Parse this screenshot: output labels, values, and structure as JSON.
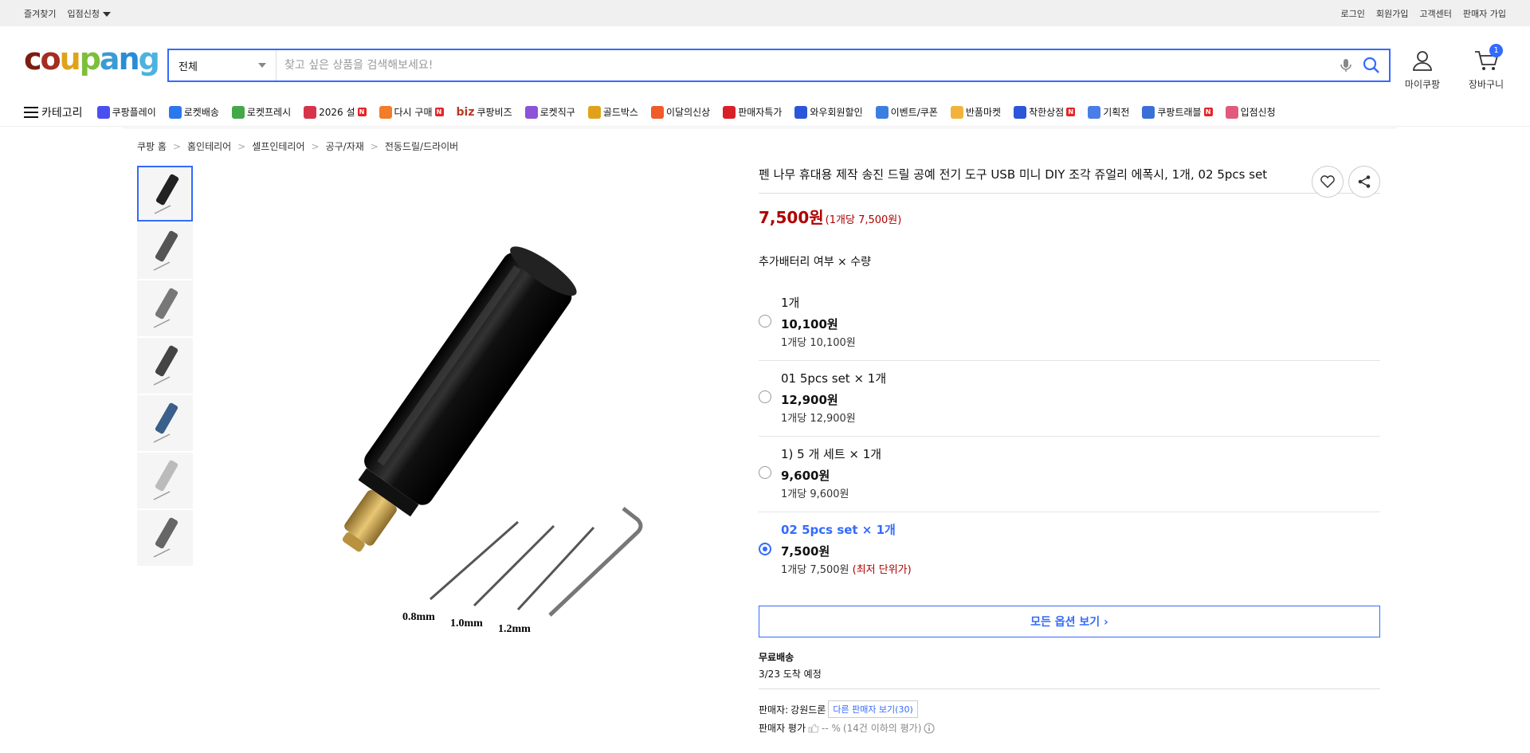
{
  "topbar": {
    "favorites": "즐겨찾기",
    "store_apply": "입점신청",
    "login": "로그인",
    "signup": "회원가입",
    "customer_center": "고객센터",
    "seller_signup": "판매자 가입"
  },
  "header": {
    "logo_letters": [
      "c",
      "o",
      "u",
      "p",
      "a",
      "n",
      "g"
    ],
    "search_category": "전체",
    "search_placeholder": "찾고 싶은 상품을 검색해보세요!",
    "mycoupang": "마이쿠팡",
    "cart": "장바구니",
    "cart_count": "1"
  },
  "catnav": {
    "category": "카테고리",
    "items": [
      {
        "label": "쿠팡플레이",
        "icon": "play-icon",
        "color": "#4a4ff0",
        "new": false
      },
      {
        "label": "로켓배송",
        "icon": "rocket-icon",
        "color": "#2b77ee",
        "new": false
      },
      {
        "label": "로켓프레시",
        "icon": "rocket-fresh-icon",
        "color": "#44a84b",
        "new": false
      },
      {
        "label": "2026 설",
        "icon": "hanbok-icon",
        "color": "#d6344b",
        "new": true
      },
      {
        "label": "다시 구매",
        "icon": "basket-icon",
        "color": "#f27c2a",
        "new": true
      },
      {
        "label": "쿠팡비즈",
        "icon": "biz-icon",
        "color": "#b43b23",
        "new": false,
        "prefix": "biz"
      },
      {
        "label": "로켓직구",
        "icon": "rocket-global-icon",
        "color": "#8c52d8",
        "new": false
      },
      {
        "label": "골드박스",
        "icon": "goldbox-icon",
        "color": "#e0a21b",
        "new": false
      },
      {
        "label": "이달의신상",
        "icon": "new-bag-icon",
        "color": "#f15a29",
        "new": false
      },
      {
        "label": "판매자특가",
        "icon": "percent-icon",
        "color": "#d92027",
        "new": false
      },
      {
        "label": "와우회원할인",
        "icon": "wow-icon",
        "color": "#2b56d9",
        "new": false
      },
      {
        "label": "이벤트/쿠폰",
        "icon": "coupon-icon",
        "color": "#3a7fe0",
        "new": false
      },
      {
        "label": "반품마켓",
        "icon": "market-icon",
        "color": "#f2b33d",
        "new": false
      },
      {
        "label": "착한상점",
        "icon": "shop-icon",
        "color": "#2b56d9",
        "new": true
      },
      {
        "label": "기획전",
        "icon": "tag-icon",
        "color": "#4a7de8",
        "new": false
      },
      {
        "label": "쿠팡트래블",
        "icon": "travel-icon",
        "color": "#3a6fd8",
        "new": true
      },
      {
        "label": "입점신청",
        "icon": "store-icon",
        "color": "#e25a7b",
        "new": false
      }
    ]
  },
  "breadcrumb": [
    "쿠팡 홈",
    "홈인테리어",
    "셀프인테리어",
    "공구/자재",
    "전동드릴/드라이버"
  ],
  "product": {
    "title": "펜 나무 휴대용 제작 송진 드릴 공예 전기 도구 USB 미니 DIY 조각 쥬얼리 에폭시, 1개, 02 5pcs set",
    "price": "7,500원",
    "unit_price": "(1개당 7,500원)",
    "option_label": "추가배터리 여부 × 수량",
    "options": [
      {
        "name": "1개",
        "price": "10,100원",
        "unit": "1개당 10,100원",
        "note": "",
        "selected": false
      },
      {
        "name": "01 5pcs set × 1개",
        "price": "12,900원",
        "unit": "1개당 12,900원",
        "note": "",
        "selected": false
      },
      {
        "name": "1) 5 개 세트 × 1개",
        "price": "9,600원",
        "unit": "1개당 9,600원",
        "note": "",
        "selected": false
      },
      {
        "name": "02 5pcs set × 1개",
        "price": "7,500원",
        "unit": "1개당 7,500원",
        "note": "(최저 단위가)",
        "selected": true
      }
    ],
    "all_options": "모든 옵션 보기 ›",
    "shipping_title": "무료배송",
    "shipping_date": "3/23 도착 예정",
    "seller_label": "판매자:",
    "seller_name": "강원드론",
    "other_sellers": "다른 판매자 보기(30)",
    "seller_rating_label": "판매자 평가",
    "seller_rating_value": "-- %",
    "seller_rating_note": "(14건 이하의 평가)"
  },
  "image": {
    "labels": [
      "0.8mm",
      "1.0mm",
      "1.2mm"
    ]
  }
}
